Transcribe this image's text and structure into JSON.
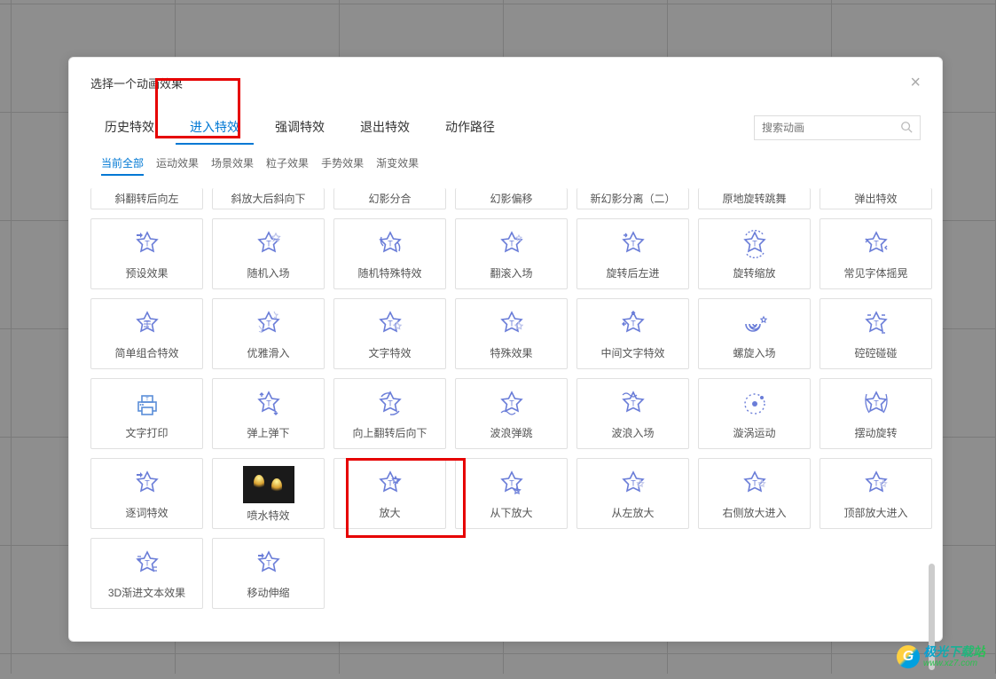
{
  "dialog": {
    "title": "选择一个动画效果",
    "close": "×"
  },
  "search": {
    "placeholder": "搜索动画"
  },
  "main_tabs": [
    {
      "label": "历史特效",
      "active": false
    },
    {
      "label": "进入特效",
      "active": true
    },
    {
      "label": "强调特效",
      "active": false
    },
    {
      "label": "退出特效",
      "active": false
    },
    {
      "label": "动作路径",
      "active": false
    }
  ],
  "sub_tabs": [
    {
      "label": "当前全部",
      "active": true
    },
    {
      "label": "运动效果",
      "active": false
    },
    {
      "label": "场景效果",
      "active": false
    },
    {
      "label": "粒子效果",
      "active": false
    },
    {
      "label": "手势效果",
      "active": false
    },
    {
      "label": "渐变效果",
      "active": false
    }
  ],
  "top_partial_row": [
    {
      "label": "斜翻转后向左"
    },
    {
      "label": "斜放大后斜向下"
    },
    {
      "label": "幻影分合"
    },
    {
      "label": "幻影偏移"
    },
    {
      "label": "新幻影分离（二）"
    },
    {
      "label": "原地旋转跳舞"
    },
    {
      "label": "弹出特效"
    }
  ],
  "effects": [
    {
      "label": "预设效果",
      "icon": "star_arrow"
    },
    {
      "label": "随机入场",
      "icon": "star_double"
    },
    {
      "label": "随机特殊特效",
      "icon": "star_swap"
    },
    {
      "label": "翻滚入场",
      "icon": "star_roll"
    },
    {
      "label": "旋转后左进",
      "icon": "star_rotate"
    },
    {
      "label": "旋转缩放",
      "icon": "star_spin"
    },
    {
      "label": "常见字体摇晃",
      "icon": "star_shake"
    },
    {
      "label": "简单组合特效",
      "icon": "star_lines"
    },
    {
      "label": "优雅滑入",
      "icon": "star_trail"
    },
    {
      "label": "文字特效",
      "icon": "star_pair"
    },
    {
      "label": "特殊效果",
      "icon": "star_pair"
    },
    {
      "label": "中间文字特效",
      "icon": "star_arrows"
    },
    {
      "label": "螺旋入场",
      "icon": "spiral"
    },
    {
      "label": "硿硿碰碰",
      "icon": "star_bounce"
    },
    {
      "label": "文字打印",
      "icon": "printer"
    },
    {
      "label": "弹上弹下",
      "icon": "star_updown"
    },
    {
      "label": "向上翻转后向下",
      "icon": "star_flip"
    },
    {
      "label": "波浪弹跳",
      "icon": "star_wave"
    },
    {
      "label": "波浪入场",
      "icon": "star_wave2"
    },
    {
      "label": "漩涡运动",
      "icon": "vortex"
    },
    {
      "label": "摆动旋转",
      "icon": "star_swing"
    },
    {
      "label": "逐词特效",
      "icon": "star_arrow"
    },
    {
      "label": "喷水特效",
      "icon": "firework"
    },
    {
      "label": "放大",
      "icon": "star_zoom"
    },
    {
      "label": "从下放大",
      "icon": "star_zoom_down"
    },
    {
      "label": "从左放大",
      "icon": "star_zoom_ghost"
    },
    {
      "label": "右侧放大进入",
      "icon": "star_zoom_ghost"
    },
    {
      "label": "顶部放大进入",
      "icon": "star_zoom_ghost"
    },
    {
      "label": "3D渐进文本效果",
      "icon": "star_3d"
    },
    {
      "label": "移动伸缩",
      "icon": "star_stretch"
    }
  ],
  "watermark": {
    "cn": "极光下载站",
    "url": "www.xz7.com"
  }
}
